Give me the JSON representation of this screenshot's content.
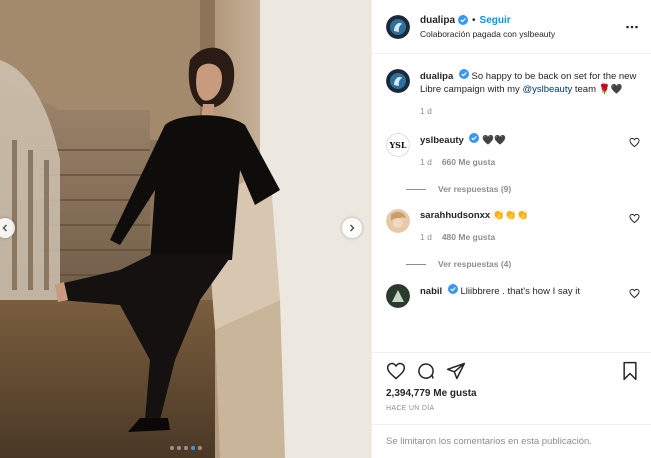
{
  "post": {
    "author": "dualipa",
    "follow_label": "Seguir",
    "separator": "•",
    "paid_partnership": "Colaboración pagada con yslbeauty",
    "caption": {
      "username": "dualipa",
      "text_before": "So happy to be back on set for the new Libre campaign with my ",
      "mention": "@yslbeauty",
      "text_after": " team 🌹🖤",
      "time": "1 d"
    },
    "comments": [
      {
        "username": "yslbeauty",
        "verified": true,
        "text": "🖤🖤",
        "time": "1 d",
        "likes": "660 Me gusta",
        "replies": "Ver respuestas (9)"
      },
      {
        "username": "sarahhudsonxx",
        "verified": false,
        "text": "👏👏👏",
        "time": "1 d",
        "likes": "480 Me gusta",
        "replies": "Ver respuestas (4)"
      },
      {
        "username": "nabil",
        "verified": true,
        "text": "Lliibbrere . that's how I say it"
      }
    ],
    "like_count": "2,394,779 Me gusta",
    "posted": "HACE UN DÍA",
    "comments_limited": "Se limitaron los comentarios en esta publicación.",
    "carousel": {
      "slides": 5,
      "active": 4
    }
  },
  "colors": {
    "accent": "#0095f6",
    "verified": "#3897f0",
    "text": "#262626",
    "muted": "#8e8e8e"
  },
  "icons": [
    "chevron-left-icon",
    "chevron-right-icon",
    "more-icon",
    "verified-icon",
    "heart-icon",
    "comment-icon",
    "share-icon",
    "bookmark-icon"
  ]
}
